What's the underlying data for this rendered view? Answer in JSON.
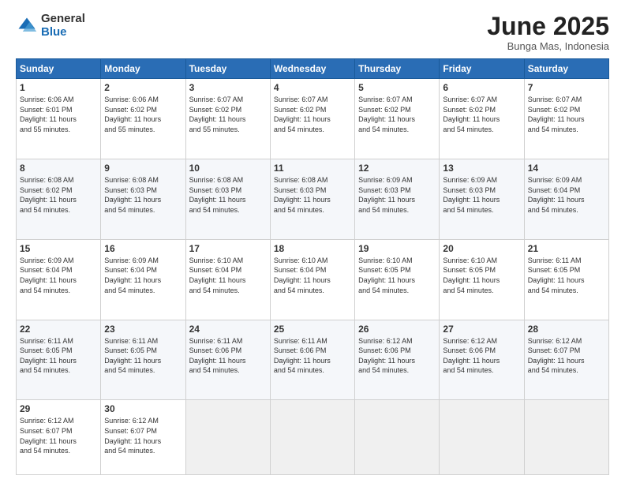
{
  "logo": {
    "general": "General",
    "blue": "Blue"
  },
  "header": {
    "month_year": "June 2025",
    "location": "Bunga Mas, Indonesia"
  },
  "days": [
    "Sunday",
    "Monday",
    "Tuesday",
    "Wednesday",
    "Thursday",
    "Friday",
    "Saturday"
  ],
  "weeks": [
    [
      {
        "day": "1",
        "sunrise": "6:06 AM",
        "sunset": "6:01 PM",
        "daylight": "11 hours and 55 minutes."
      },
      {
        "day": "2",
        "sunrise": "6:06 AM",
        "sunset": "6:02 PM",
        "daylight": "11 hours and 55 minutes."
      },
      {
        "day": "3",
        "sunrise": "6:07 AM",
        "sunset": "6:02 PM",
        "daylight": "11 hours and 55 minutes."
      },
      {
        "day": "4",
        "sunrise": "6:07 AM",
        "sunset": "6:02 PM",
        "daylight": "11 hours and 54 minutes."
      },
      {
        "day": "5",
        "sunrise": "6:07 AM",
        "sunset": "6:02 PM",
        "daylight": "11 hours and 54 minutes."
      },
      {
        "day": "6",
        "sunrise": "6:07 AM",
        "sunset": "6:02 PM",
        "daylight": "11 hours and 54 minutes."
      },
      {
        "day": "7",
        "sunrise": "6:07 AM",
        "sunset": "6:02 PM",
        "daylight": "11 hours and 54 minutes."
      }
    ],
    [
      {
        "day": "8",
        "sunrise": "6:08 AM",
        "sunset": "6:02 PM",
        "daylight": "11 hours and 54 minutes."
      },
      {
        "day": "9",
        "sunrise": "6:08 AM",
        "sunset": "6:03 PM",
        "daylight": "11 hours and 54 minutes."
      },
      {
        "day": "10",
        "sunrise": "6:08 AM",
        "sunset": "6:03 PM",
        "daylight": "11 hours and 54 minutes."
      },
      {
        "day": "11",
        "sunrise": "6:08 AM",
        "sunset": "6:03 PM",
        "daylight": "11 hours and 54 minutes."
      },
      {
        "day": "12",
        "sunrise": "6:09 AM",
        "sunset": "6:03 PM",
        "daylight": "11 hours and 54 minutes."
      },
      {
        "day": "13",
        "sunrise": "6:09 AM",
        "sunset": "6:03 PM",
        "daylight": "11 hours and 54 minutes."
      },
      {
        "day": "14",
        "sunrise": "6:09 AM",
        "sunset": "6:04 PM",
        "daylight": "11 hours and 54 minutes."
      }
    ],
    [
      {
        "day": "15",
        "sunrise": "6:09 AM",
        "sunset": "6:04 PM",
        "daylight": "11 hours and 54 minutes."
      },
      {
        "day": "16",
        "sunrise": "6:09 AM",
        "sunset": "6:04 PM",
        "daylight": "11 hours and 54 minutes."
      },
      {
        "day": "17",
        "sunrise": "6:10 AM",
        "sunset": "6:04 PM",
        "daylight": "11 hours and 54 minutes."
      },
      {
        "day": "18",
        "sunrise": "6:10 AM",
        "sunset": "6:04 PM",
        "daylight": "11 hours and 54 minutes."
      },
      {
        "day": "19",
        "sunrise": "6:10 AM",
        "sunset": "6:05 PM",
        "daylight": "11 hours and 54 minutes."
      },
      {
        "day": "20",
        "sunrise": "6:10 AM",
        "sunset": "6:05 PM",
        "daylight": "11 hours and 54 minutes."
      },
      {
        "day": "21",
        "sunrise": "6:11 AM",
        "sunset": "6:05 PM",
        "daylight": "11 hours and 54 minutes."
      }
    ],
    [
      {
        "day": "22",
        "sunrise": "6:11 AM",
        "sunset": "6:05 PM",
        "daylight": "11 hours and 54 minutes."
      },
      {
        "day": "23",
        "sunrise": "6:11 AM",
        "sunset": "6:05 PM",
        "daylight": "11 hours and 54 minutes."
      },
      {
        "day": "24",
        "sunrise": "6:11 AM",
        "sunset": "6:06 PM",
        "daylight": "11 hours and 54 minutes."
      },
      {
        "day": "25",
        "sunrise": "6:11 AM",
        "sunset": "6:06 PM",
        "daylight": "11 hours and 54 minutes."
      },
      {
        "day": "26",
        "sunrise": "6:12 AM",
        "sunset": "6:06 PM",
        "daylight": "11 hours and 54 minutes."
      },
      {
        "day": "27",
        "sunrise": "6:12 AM",
        "sunset": "6:06 PM",
        "daylight": "11 hours and 54 minutes."
      },
      {
        "day": "28",
        "sunrise": "6:12 AM",
        "sunset": "6:07 PM",
        "daylight": "11 hours and 54 minutes."
      }
    ],
    [
      {
        "day": "29",
        "sunrise": "6:12 AM",
        "sunset": "6:07 PM",
        "daylight": "11 hours and 54 minutes."
      },
      {
        "day": "30",
        "sunrise": "6:12 AM",
        "sunset": "6:07 PM",
        "daylight": "11 hours and 54 minutes."
      },
      {
        "day": "",
        "sunrise": "",
        "sunset": "",
        "daylight": ""
      },
      {
        "day": "",
        "sunrise": "",
        "sunset": "",
        "daylight": ""
      },
      {
        "day": "",
        "sunrise": "",
        "sunset": "",
        "daylight": ""
      },
      {
        "day": "",
        "sunrise": "",
        "sunset": "",
        "daylight": ""
      },
      {
        "day": "",
        "sunrise": "",
        "sunset": "",
        "daylight": ""
      }
    ]
  ],
  "labels": {
    "sunrise": "Sunrise:",
    "sunset": "Sunset:",
    "daylight": "Daylight:"
  }
}
